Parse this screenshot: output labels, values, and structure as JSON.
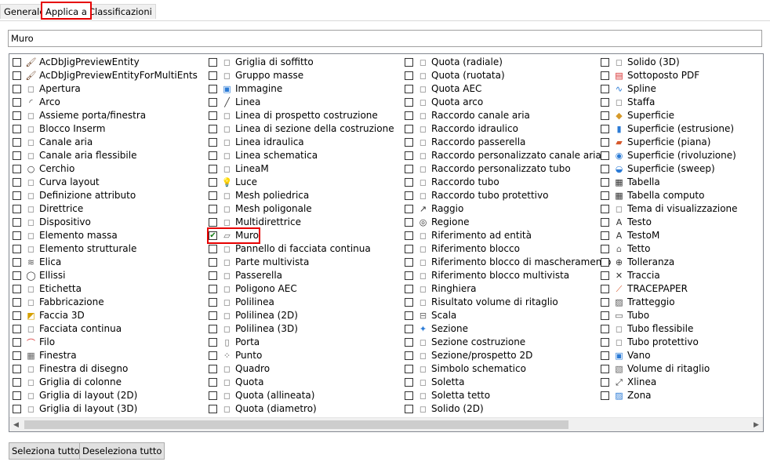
{
  "tabs": [
    {
      "label": "Generale",
      "active": false
    },
    {
      "label": "Applica a",
      "active": true
    },
    {
      "label": "Classificazioni",
      "active": false
    }
  ],
  "name_field": {
    "value": "Muro"
  },
  "columns": [
    [
      {
        "label": "AcDbJigPreviewEntity",
        "icon": "brush-icon",
        "checked": false
      },
      {
        "label": "AcDbJigPreviewEntityForMultiEnts",
        "icon": "brush-icon",
        "checked": false
      },
      {
        "label": "Apertura",
        "icon": "opening-icon",
        "checked": false
      },
      {
        "label": "Arco",
        "icon": "arc-icon",
        "checked": false
      },
      {
        "label": "Assieme porta/finestra",
        "icon": "door-window-icon",
        "checked": false
      },
      {
        "label": "Blocco Inserm",
        "icon": "block-icon",
        "checked": false
      },
      {
        "label": "Canale aria",
        "icon": "duct-icon",
        "checked": false
      },
      {
        "label": "Canale aria flessibile",
        "icon": "flex-duct-icon",
        "checked": false
      },
      {
        "label": "Cerchio",
        "icon": "circle-icon",
        "checked": false
      },
      {
        "label": "Curva layout",
        "icon": "layout-curve-icon",
        "checked": false
      },
      {
        "label": "Definizione attributo",
        "icon": "attribute-icon",
        "checked": false
      },
      {
        "label": "Direttrice",
        "icon": "leader-icon",
        "checked": false
      },
      {
        "label": "Dispositivo",
        "icon": "device-icon",
        "checked": false
      },
      {
        "label": "Elemento massa",
        "icon": "mass-element-icon",
        "checked": false
      },
      {
        "label": "Elemento strutturale",
        "icon": "structural-member-icon",
        "checked": false
      },
      {
        "label": "Elica",
        "icon": "helix-icon",
        "checked": false
      },
      {
        "label": "Ellissi",
        "icon": "ellipse-icon",
        "checked": false
      },
      {
        "label": "Etichetta",
        "icon": "label-icon",
        "checked": false
      },
      {
        "label": "Fabbricazione",
        "icon": "fabrication-icon",
        "checked": false
      },
      {
        "label": "Faccia 3D",
        "icon": "face3d-icon",
        "checked": false
      },
      {
        "label": "Facciata continua",
        "icon": "curtain-wall-icon",
        "checked": false
      },
      {
        "label": "Filo",
        "icon": "wire-icon",
        "checked": false
      },
      {
        "label": "Finestra",
        "icon": "window-icon",
        "checked": false
      },
      {
        "label": "Finestra di disegno",
        "icon": "viewport-icon",
        "checked": false
      },
      {
        "label": "Griglia di colonne",
        "icon": "column-grid-icon",
        "checked": false
      },
      {
        "label": "Griglia di layout (2D)",
        "icon": "layout-grid-icon",
        "checked": false
      },
      {
        "label": "Griglia di layout (3D)",
        "icon": "layout-grid-3d-icon",
        "checked": false
      }
    ],
    [
      {
        "label": "Griglia di soffitto",
        "icon": "ceiling-grid-icon",
        "checked": false
      },
      {
        "label": "Gruppo masse",
        "icon": "mass-group-icon",
        "checked": false
      },
      {
        "label": "Immagine",
        "icon": "image-icon",
        "checked": false
      },
      {
        "label": "Linea",
        "icon": "line-icon",
        "checked": false
      },
      {
        "label": "Linea di prospetto costruzione",
        "icon": "elevation-line-icon",
        "checked": false
      },
      {
        "label": "Linea di sezione della costruzione",
        "icon": "section-line-icon",
        "checked": false
      },
      {
        "label": "Linea idraulica",
        "icon": "pipe-line-icon",
        "checked": false
      },
      {
        "label": "Linea schematica",
        "icon": "schematic-line-icon",
        "checked": false
      },
      {
        "label": "LineaM",
        "icon": "mline-icon",
        "checked": false
      },
      {
        "label": "Luce",
        "icon": "light-icon",
        "checked": false
      },
      {
        "label": "Mesh poliedrica",
        "icon": "polyface-mesh-icon",
        "checked": false
      },
      {
        "label": "Mesh poligonale",
        "icon": "polygon-mesh-icon",
        "checked": false
      },
      {
        "label": "Multidirettrice",
        "icon": "multileader-icon",
        "checked": false
      },
      {
        "label": "Muro",
        "icon": "wall-icon",
        "checked": true,
        "highlight": true
      },
      {
        "label": "Pannello di facciata continua",
        "icon": "curtain-panel-icon",
        "checked": false
      },
      {
        "label": "Parte multivista",
        "icon": "multiview-part-icon",
        "checked": false
      },
      {
        "label": "Passerella",
        "icon": "cable-tray-icon",
        "checked": false
      },
      {
        "label": "Poligono AEC",
        "icon": "aec-polygon-icon",
        "checked": false
      },
      {
        "label": "Polilinea",
        "icon": "polyline-icon",
        "checked": false
      },
      {
        "label": "Polilinea (2D)",
        "icon": "polyline-2d-icon",
        "checked": false
      },
      {
        "label": "Polilinea (3D)",
        "icon": "polyline-3d-icon",
        "checked": false
      },
      {
        "label": "Porta",
        "icon": "door-icon",
        "checked": false
      },
      {
        "label": "Punto",
        "icon": "point-icon",
        "checked": false
      },
      {
        "label": "Quadro",
        "icon": "panel-icon",
        "checked": false
      },
      {
        "label": "Quota",
        "icon": "dimension-icon",
        "checked": false
      },
      {
        "label": "Quota (allineata)",
        "icon": "dimension-aligned-icon",
        "checked": false
      },
      {
        "label": "Quota (diametro)",
        "icon": "dimension-diameter-icon",
        "checked": false
      }
    ],
    [
      {
        "label": "Quota (radiale)",
        "icon": "dimension-radial-icon",
        "checked": false
      },
      {
        "label": "Quota (ruotata)",
        "icon": "dimension-rotated-icon",
        "checked": false
      },
      {
        "label": "Quota AEC",
        "icon": "aec-dimension-icon",
        "checked": false
      },
      {
        "label": "Quota arco",
        "icon": "arc-dimension-icon",
        "checked": false
      },
      {
        "label": "Raccordo canale aria",
        "icon": "duct-fitting-icon",
        "checked": false
      },
      {
        "label": "Raccordo idraulico",
        "icon": "pipe-fitting-icon",
        "checked": false
      },
      {
        "label": "Raccordo passerella",
        "icon": "tray-fitting-icon",
        "checked": false
      },
      {
        "label": "Raccordo personalizzato canale aria",
        "icon": "custom-duct-fitting-icon",
        "checked": false
      },
      {
        "label": "Raccordo personalizzato tubo",
        "icon": "custom-pipe-fitting-icon",
        "checked": false
      },
      {
        "label": "Raccordo tubo",
        "icon": "conduit-fitting-icon",
        "checked": false
      },
      {
        "label": "Raccordo tubo protettivo",
        "icon": "protective-fitting-icon",
        "checked": false
      },
      {
        "label": "Raggio",
        "icon": "ray-icon",
        "checked": false
      },
      {
        "label": "Regione",
        "icon": "region-icon",
        "checked": false
      },
      {
        "label": "Riferimento ad entità",
        "icon": "entity-reference-icon",
        "checked": false
      },
      {
        "label": "Riferimento blocco",
        "icon": "block-reference-icon",
        "checked": false
      },
      {
        "label": "Riferimento blocco di mascheramento",
        "icon": "mask-block-icon",
        "checked": false
      },
      {
        "label": "Riferimento blocco multivista",
        "icon": "multiview-block-icon",
        "checked": false
      },
      {
        "label": "Ringhiera",
        "icon": "railing-icon",
        "checked": false
      },
      {
        "label": "Risultato volume di ritaglio",
        "icon": "clip-volume-result-icon",
        "checked": false
      },
      {
        "label": "Scala",
        "icon": "stair-icon",
        "checked": false
      },
      {
        "label": "Sezione",
        "icon": "section-icon",
        "checked": false
      },
      {
        "label": "Sezione costruzione",
        "icon": "building-section-icon",
        "checked": false
      },
      {
        "label": "Sezione/prospetto 2D",
        "icon": "section-elevation-icon",
        "checked": false
      },
      {
        "label": "Simbolo schematico",
        "icon": "schematic-symbol-icon",
        "checked": false
      },
      {
        "label": "Soletta",
        "icon": "slab-icon",
        "checked": false
      },
      {
        "label": "Soletta tetto",
        "icon": "roof-slab-icon",
        "checked": false
      },
      {
        "label": "Solido (2D)",
        "icon": "solid-2d-icon",
        "checked": false
      }
    ],
    [
      {
        "label": "Solido (3D)",
        "icon": "solid-3d-icon",
        "checked": false
      },
      {
        "label": "Sottoposto PDF",
        "icon": "pdf-underlay-icon",
        "checked": false
      },
      {
        "label": "Spline",
        "icon": "spline-icon",
        "checked": false
      },
      {
        "label": "Staffa",
        "icon": "hanger-icon",
        "checked": false
      },
      {
        "label": "Superficie",
        "icon": "surface-icon",
        "checked": false
      },
      {
        "label": "Superficie (estrusione)",
        "icon": "surface-extrude-icon",
        "checked": false
      },
      {
        "label": "Superficie (piana)",
        "icon": "surface-planar-icon",
        "checked": false
      },
      {
        "label": "Superficie (rivoluzione)",
        "icon": "surface-revolve-icon",
        "checked": false
      },
      {
        "label": "Superficie (sweep)",
        "icon": "surface-sweep-icon",
        "checked": false
      },
      {
        "label": "Tabella",
        "icon": "table-icon",
        "checked": false
      },
      {
        "label": "Tabella computo",
        "icon": "schedule-table-icon",
        "checked": false
      },
      {
        "label": "Tema di visualizzazione",
        "icon": "display-theme-icon",
        "checked": false
      },
      {
        "label": "Testo",
        "icon": "text-icon",
        "checked": false
      },
      {
        "label": "TestoM",
        "icon": "mtext-icon",
        "checked": false
      },
      {
        "label": "Tetto",
        "icon": "roof-icon",
        "checked": false
      },
      {
        "label": "Tolleranza",
        "icon": "tolerance-icon",
        "checked": false
      },
      {
        "label": "Traccia",
        "icon": "trace-icon",
        "checked": false
      },
      {
        "label": "TRACEPAPER",
        "icon": "tracepaper-icon",
        "checked": false
      },
      {
        "label": "Tratteggio",
        "icon": "hatch-icon",
        "checked": false
      },
      {
        "label": "Tubo",
        "icon": "pipe-icon",
        "checked": false
      },
      {
        "label": "Tubo flessibile",
        "icon": "flex-pipe-icon",
        "checked": false
      },
      {
        "label": "Tubo protettivo",
        "icon": "conduit-icon",
        "checked": false
      },
      {
        "label": "Vano",
        "icon": "space-icon",
        "checked": false
      },
      {
        "label": "Volume di ritaglio",
        "icon": "clip-volume-icon",
        "checked": false
      },
      {
        "label": "Xlinea",
        "icon": "xline-icon",
        "checked": false
      },
      {
        "label": "Zona",
        "icon": "zone-icon",
        "checked": false
      }
    ]
  ],
  "buttons": {
    "select_all": "Seleziona tutto",
    "deselect_all": "Deseleziona tutto"
  },
  "colors": {
    "highlight": "#e60000",
    "check": "#1a7f1a"
  }
}
